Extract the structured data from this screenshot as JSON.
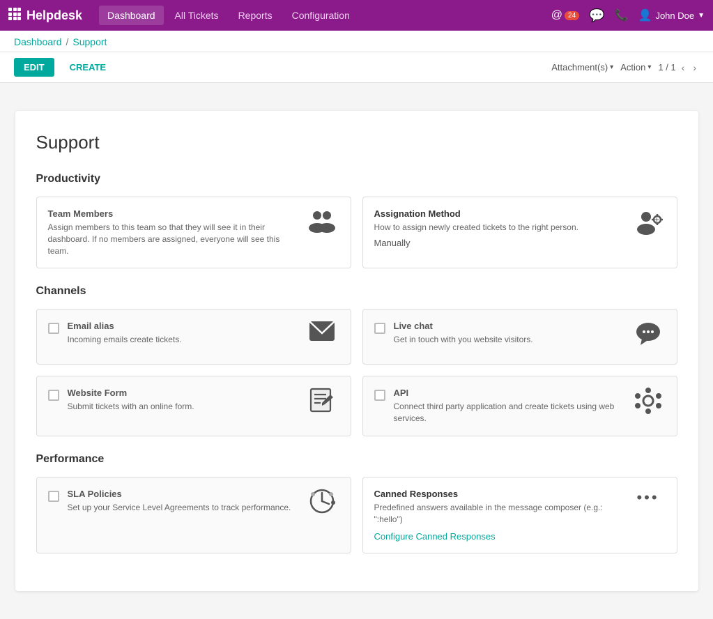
{
  "nav": {
    "brand": "Helpdesk",
    "links": [
      "Dashboard",
      "All Tickets",
      "Reports",
      "Configuration"
    ],
    "active_link": "Dashboard",
    "notifications": "24",
    "user": "John Doe"
  },
  "breadcrumb": {
    "parent": "Dashboard",
    "separator": "/",
    "current": "Support"
  },
  "toolbar": {
    "edit_label": "EDIT",
    "create_label": "CREATE",
    "attachments_label": "Attachment(s)",
    "action_label": "Action",
    "pagination": "1 / 1"
  },
  "page": {
    "title": "Support"
  },
  "sections": [
    {
      "id": "productivity",
      "title": "Productivity",
      "cards": [
        {
          "id": "team-members",
          "title": "Team Members",
          "description": "Assign members to this team so that they will see it in their dashboard. If no members are assigned, everyone will see this team.",
          "icon": "team",
          "has_checkbox": false,
          "active": true
        },
        {
          "id": "assignation-method",
          "title": "Assignation Method",
          "description": "How to assign newly created tickets to the right person.",
          "value": "Manually",
          "icon": "assign",
          "has_checkbox": false,
          "active": true
        }
      ]
    },
    {
      "id": "channels",
      "title": "Channels",
      "cards": [
        {
          "id": "email-alias",
          "title": "Email alias",
          "description": "Incoming emails create tickets.",
          "icon": "email",
          "has_checkbox": true,
          "active": false
        },
        {
          "id": "live-chat",
          "title": "Live chat",
          "description": "Get in touch with you website visitors.",
          "icon": "chat",
          "has_checkbox": true,
          "active": false
        },
        {
          "id": "website-form",
          "title": "Website Form",
          "description": "Submit tickets with an online form.",
          "icon": "form",
          "has_checkbox": true,
          "active": false
        },
        {
          "id": "api",
          "title": "API",
          "description": "Connect third party application and create tickets using web services.",
          "icon": "api",
          "has_checkbox": true,
          "active": false
        }
      ]
    },
    {
      "id": "performance",
      "title": "Performance",
      "cards": [
        {
          "id": "sla-policies",
          "title": "SLA Policies",
          "description": "Set up your Service Level Agreements to track performance.",
          "icon": "sla",
          "has_checkbox": true,
          "active": false
        },
        {
          "id": "canned-responses",
          "title": "Canned Responses",
          "description": "Predefined answers available in the message composer (e.g.: \":hello\")",
          "link_label": "Configure Canned Responses",
          "icon": "canned",
          "has_checkbox": false,
          "active": true
        }
      ]
    }
  ]
}
